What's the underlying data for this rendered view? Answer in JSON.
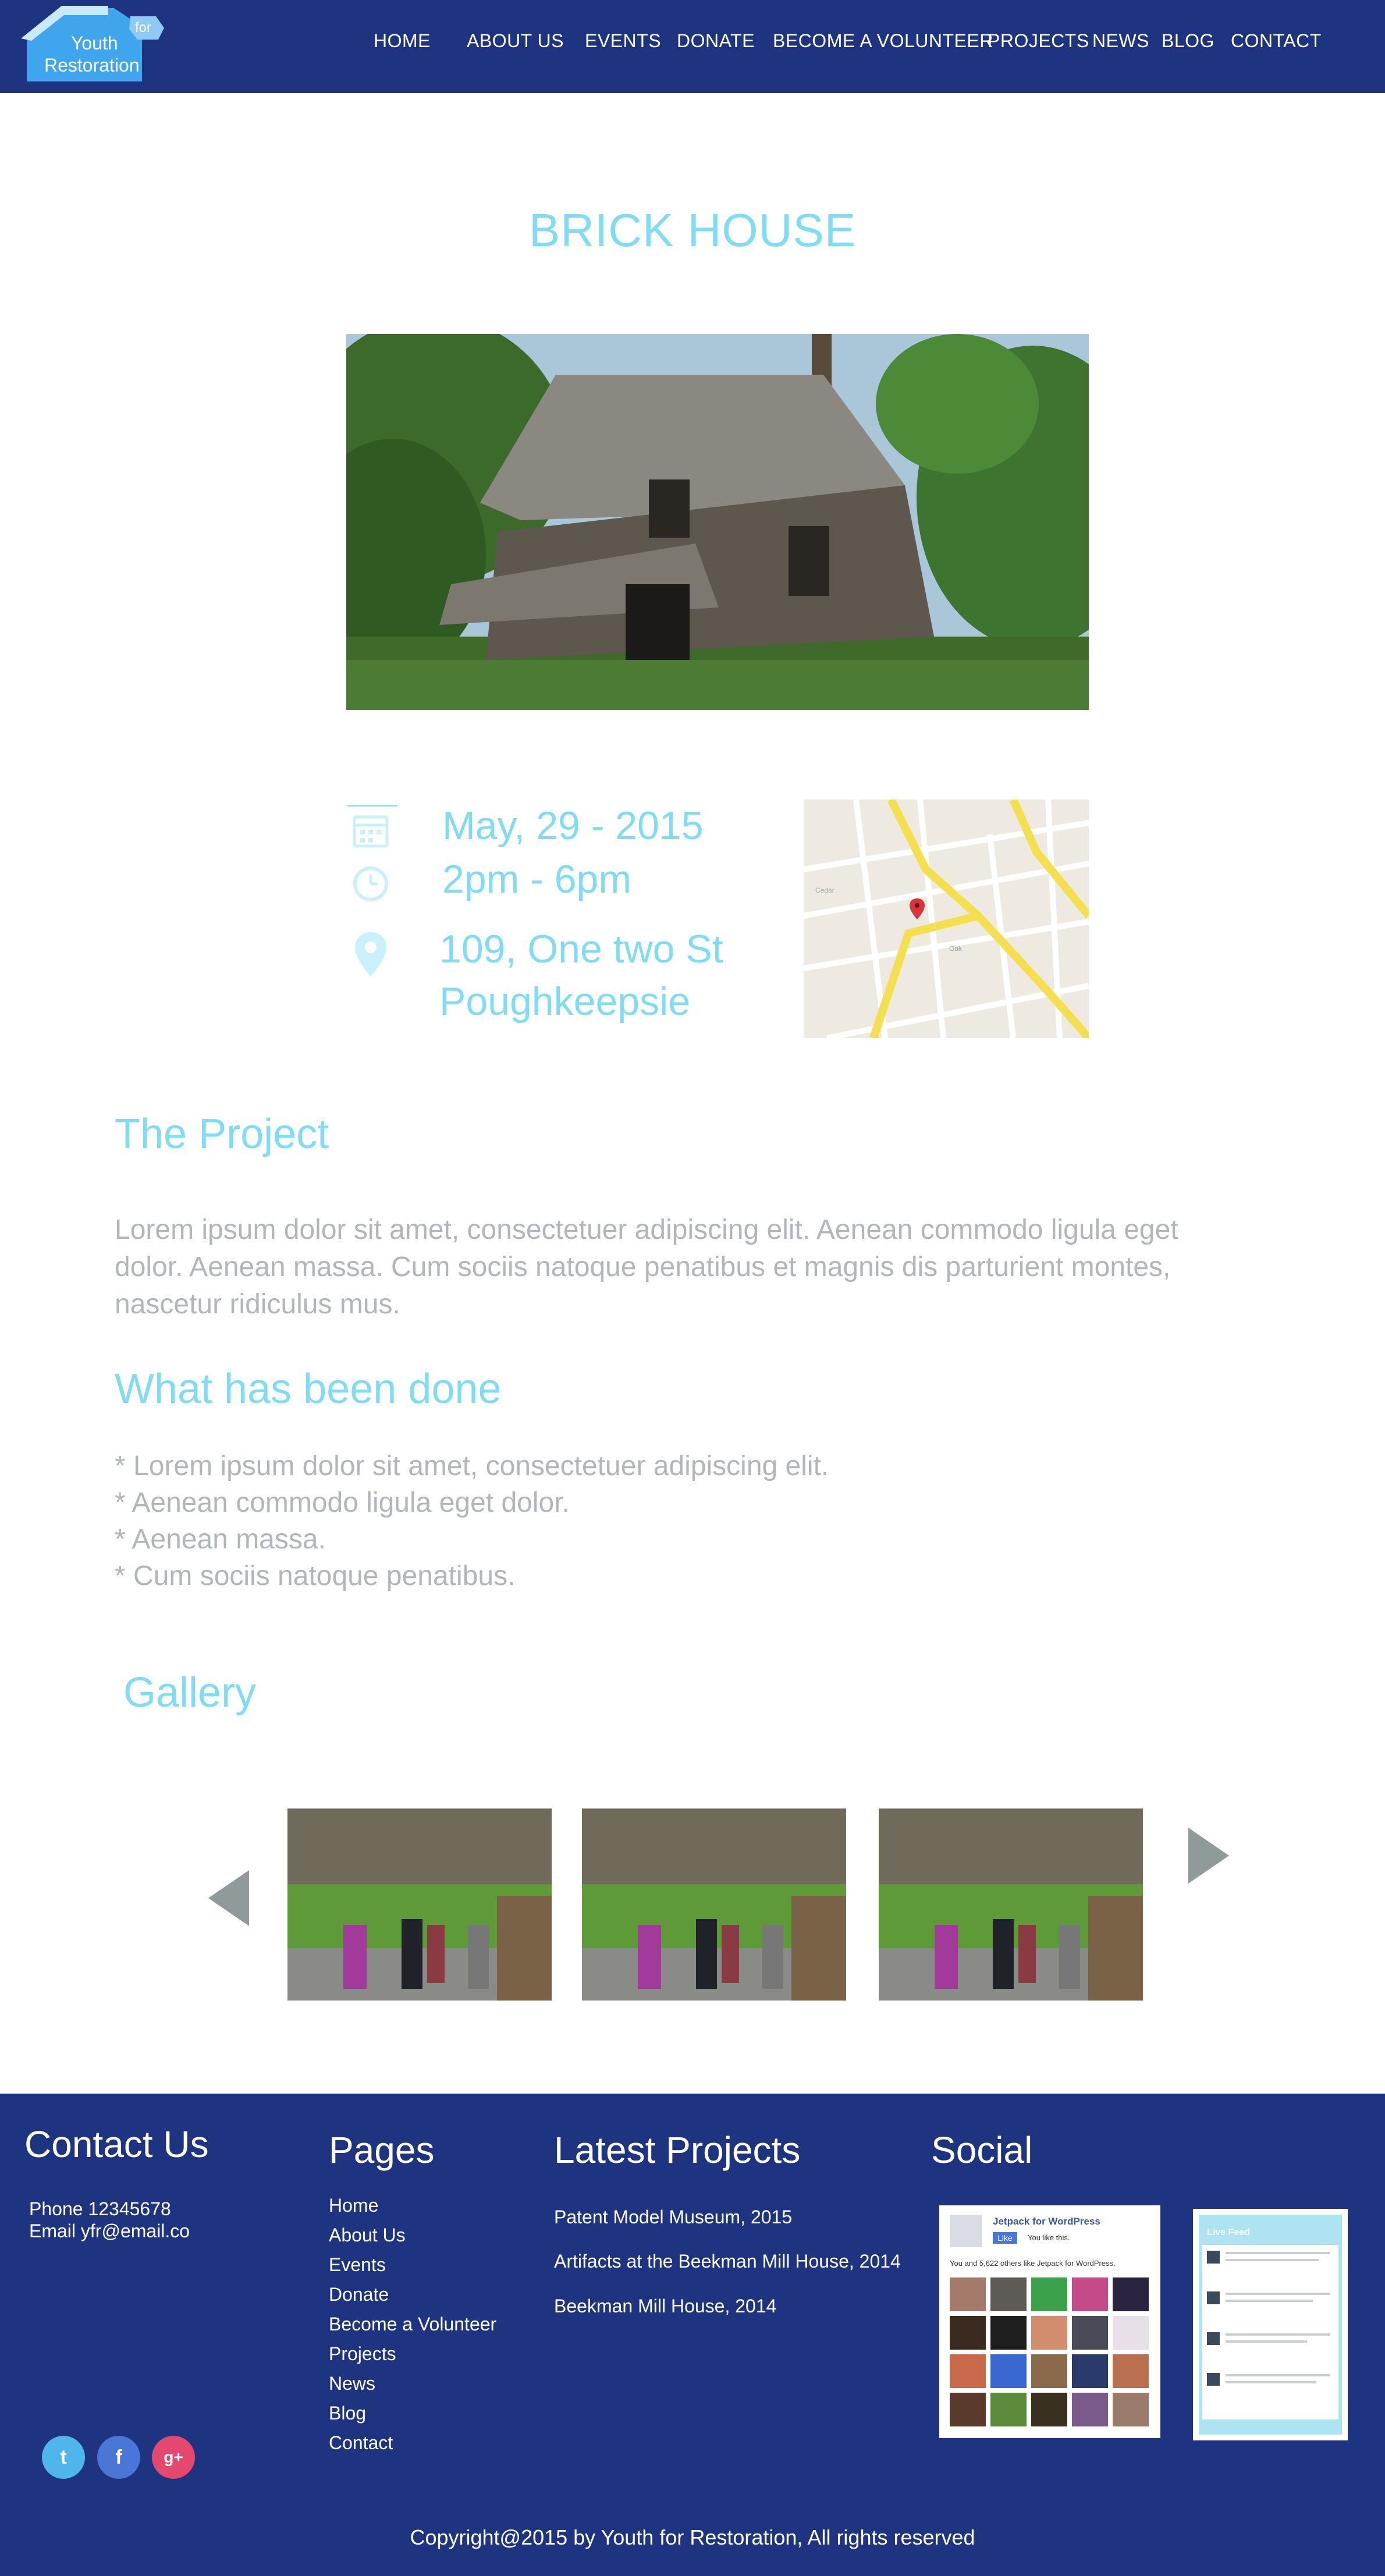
{
  "header": {
    "logo": {
      "line1": "Youth",
      "line2": "for",
      "line3": "Restoration"
    },
    "nav": [
      "HOME",
      "ABOUT US",
      "EVENTS",
      "DONATE",
      "BECOME A VOLUNTEER",
      "PROJECTS",
      "NEWS",
      "BLOG",
      "CONTACT"
    ]
  },
  "page": {
    "title": "BRICK HOUSE"
  },
  "event": {
    "date": "May, 29 - 2015",
    "time": "2pm - 6pm",
    "address_line1": "109, One two St",
    "address_line2": "Poughkeepsie",
    "icons": [
      "calendar-icon",
      "clock-icon",
      "location-pin-icon"
    ]
  },
  "project": {
    "heading": "The Project",
    "text": "Lorem ipsum dolor sit amet, consectetuer adipiscing elit. Aenean commodo ligula eget dolor. Aenean massa. Cum sociis natoque penatibus et magnis dis parturient montes, nascetur ridiculus mus."
  },
  "done": {
    "heading": "What has been done",
    "items": [
      "*  Lorem ipsum dolor sit amet, consectetuer adipiscing elit.",
      "*  Aenean commodo ligula eget dolor.",
      "* Aenean massa.",
      "* Cum sociis natoque penatibus."
    ]
  },
  "gallery": {
    "heading": "Gallery"
  },
  "footer": {
    "contact": {
      "heading": "Contact Us",
      "phone": "Phone 12345678",
      "email": "Email yfr@email.co"
    },
    "pages": {
      "heading": "Pages",
      "links": [
        "Home",
        "About Us",
        "Events",
        "Donate",
        "Become a Volunteer",
        "Projects",
        "News",
        "Blog",
        "Contact"
      ]
    },
    "latest": {
      "heading": "Latest Projects",
      "items": [
        "Patent Model Museum, 2015",
        "Artifacts at the Beekman Mill House, 2014",
        "Beekman Mill House, 2014"
      ]
    },
    "social": {
      "heading": "Social",
      "fb_widget": {
        "title": "Jetpack for WordPress",
        "like": "Like",
        "you_like": "You like this.",
        "count_text": "You and 5,622 others like Jetpack for WordPress."
      },
      "tw_widget": {
        "title": "Live Feed"
      },
      "buttons": [
        "t",
        "f",
        "g+"
      ]
    },
    "copyright": "Copyright@2015 by Youth for Restoration, All rights reserved"
  },
  "colors": {
    "header_bg": "#1e3481",
    "accent": "#7fdcf4",
    "body_text": "#b2b6ba",
    "twitter": "#4fb6ec",
    "facebook": "#4a76d8",
    "google": "#e5486e"
  }
}
